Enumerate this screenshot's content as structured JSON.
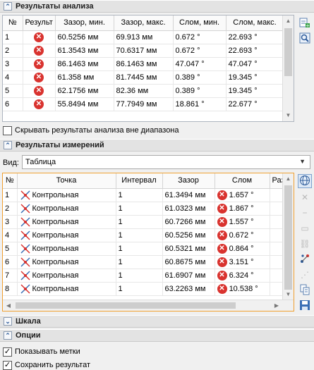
{
  "analysis": {
    "title": "Результаты анализа",
    "columns": [
      "№",
      "Результ",
      "Зазор, мин.",
      "Зазор, макс.",
      "Слом, мин.",
      "Слом, макс."
    ],
    "rows": [
      {
        "n": "1",
        "min": "60.5256 мм",
        "max": "69.913 мм",
        "smin": "0.672 °",
        "smax": "22.693 °"
      },
      {
        "n": "2",
        "min": "61.3543 мм",
        "max": "70.6317 мм",
        "smin": "0.672 °",
        "smax": "22.693 °"
      },
      {
        "n": "3",
        "min": "86.1463 мм",
        "max": "86.1463 мм",
        "smin": "47.047 °",
        "smax": "47.047 °"
      },
      {
        "n": "4",
        "min": "61.358 мм",
        "max": "81.7445 мм",
        "smin": "0.389 °",
        "smax": "19.345 °"
      },
      {
        "n": "5",
        "min": "62.1756 мм",
        "max": "82.36 мм",
        "smin": "0.389 °",
        "smax": "19.345 °"
      },
      {
        "n": "6",
        "min": "55.8494 мм",
        "max": "77.7949 мм",
        "smin": "18.861 °",
        "smax": "22.677 °"
      }
    ],
    "hide_out_of_range_label": "Скрывать результаты анализа вне диапазона",
    "hide_out_of_range_checked": false
  },
  "measurements": {
    "title": "Результаты измерений",
    "view_label": "Вид:",
    "view_value": "Таблица",
    "columns": [
      "№",
      "Точка",
      "Интервал",
      "Зазор",
      "Слом",
      "Раз"
    ],
    "rows": [
      {
        "n": "1",
        "point": "Контрольная",
        "interval": "1",
        "gap": "61.3494 мм",
        "slom": "1.657 °"
      },
      {
        "n": "2",
        "point": "Контрольная",
        "interval": "1",
        "gap": "61.0323 мм",
        "slom": "1.867 °"
      },
      {
        "n": "3",
        "point": "Контрольная",
        "interval": "1",
        "gap": "60.7266 мм",
        "slom": "1.557 °"
      },
      {
        "n": "4",
        "point": "Контрольная",
        "interval": "1",
        "gap": "60.5256 мм",
        "slom": "0.672 °"
      },
      {
        "n": "5",
        "point": "Контрольная",
        "interval": "1",
        "gap": "60.5321 мм",
        "slom": "0.864 °"
      },
      {
        "n": "6",
        "point": "Контрольная",
        "interval": "1",
        "gap": "60.8675 мм",
        "slom": "3.151 °"
      },
      {
        "n": "7",
        "point": "Контрольная",
        "interval": "1",
        "gap": "61.6907 мм",
        "slom": "6.324 °"
      },
      {
        "n": "8",
        "point": "Контрольная",
        "interval": "1",
        "gap": "63.2263 мм",
        "slom": "10.538 °"
      }
    ]
  },
  "scale": {
    "title": "Шкала"
  },
  "options": {
    "title": "Опции",
    "show_marks_label": "Показывать метки",
    "show_marks_checked": true,
    "save_result_label": "Сохранить результат",
    "save_result_checked": true
  },
  "colors": {
    "error": "#d9332f",
    "accent_border": "#f0a030",
    "section_bg": "#e3e3e3"
  }
}
